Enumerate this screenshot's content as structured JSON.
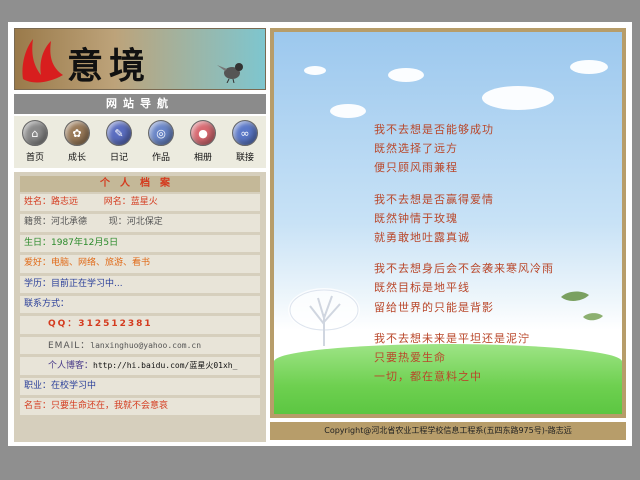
{
  "logo": {
    "brand": "意境"
  },
  "nav": {
    "title": "网站导航",
    "items": [
      {
        "label": "首页",
        "icon": "home-icon",
        "color": "#8a8a8a"
      },
      {
        "label": "成长",
        "icon": "growth-icon",
        "color": "#9a7b5a"
      },
      {
        "label": "日记",
        "icon": "diary-icon",
        "color": "#5b6ec0"
      },
      {
        "label": "作品",
        "icon": "works-icon",
        "color": "#6a86c8"
      },
      {
        "label": "相册",
        "icon": "album-icon",
        "color": "#d86a72"
      },
      {
        "label": "联接",
        "icon": "links-icon",
        "color": "#5b78c8"
      }
    ]
  },
  "profile": {
    "title": "个人档案",
    "name_label": "姓名：",
    "name_value": "路志远",
    "netname_label": "网名：",
    "netname_value": "蓝星火",
    "native": "籍贯：河北承德",
    "current": "现：河北保定",
    "birthday": "生日：1987年12月5日",
    "hobbies": "爱好：电脑、网络、旅游、看书",
    "education": "学历：目前正在学习中...",
    "contact_label": "联系方式：",
    "qq": "QQ：312512381",
    "email_label": "EMAIL：",
    "email_value": "lanxinghuo@yahoo.com.cn",
    "blog_label": "个人博客：",
    "blog_value": "http://hi.baidu.com/蓝星火01xh_",
    "job": "职业：在校学习中",
    "motto": "名言：只要生命还在，我就不会意哀"
  },
  "poem": [
    [
      "我不去想是否能够成功",
      "既然选择了远方",
      "便只顾风雨兼程"
    ],
    [
      "我不去想是否赢得爱情",
      "既然钟情于玫瑰",
      "就勇敢地吐露真诚"
    ],
    [
      "我不去想身后会不会袭来寒风冷雨",
      "既然目标是地平线",
      "留给世界的只能是背影"
    ],
    [
      "我不去想未来是平坦还是泥泞",
      "只要热爱生命",
      "一切，都在意料之中"
    ]
  ],
  "footer": "Copyright@河北省农业工程学校信息工程系(五四东路975号)-路志远"
}
